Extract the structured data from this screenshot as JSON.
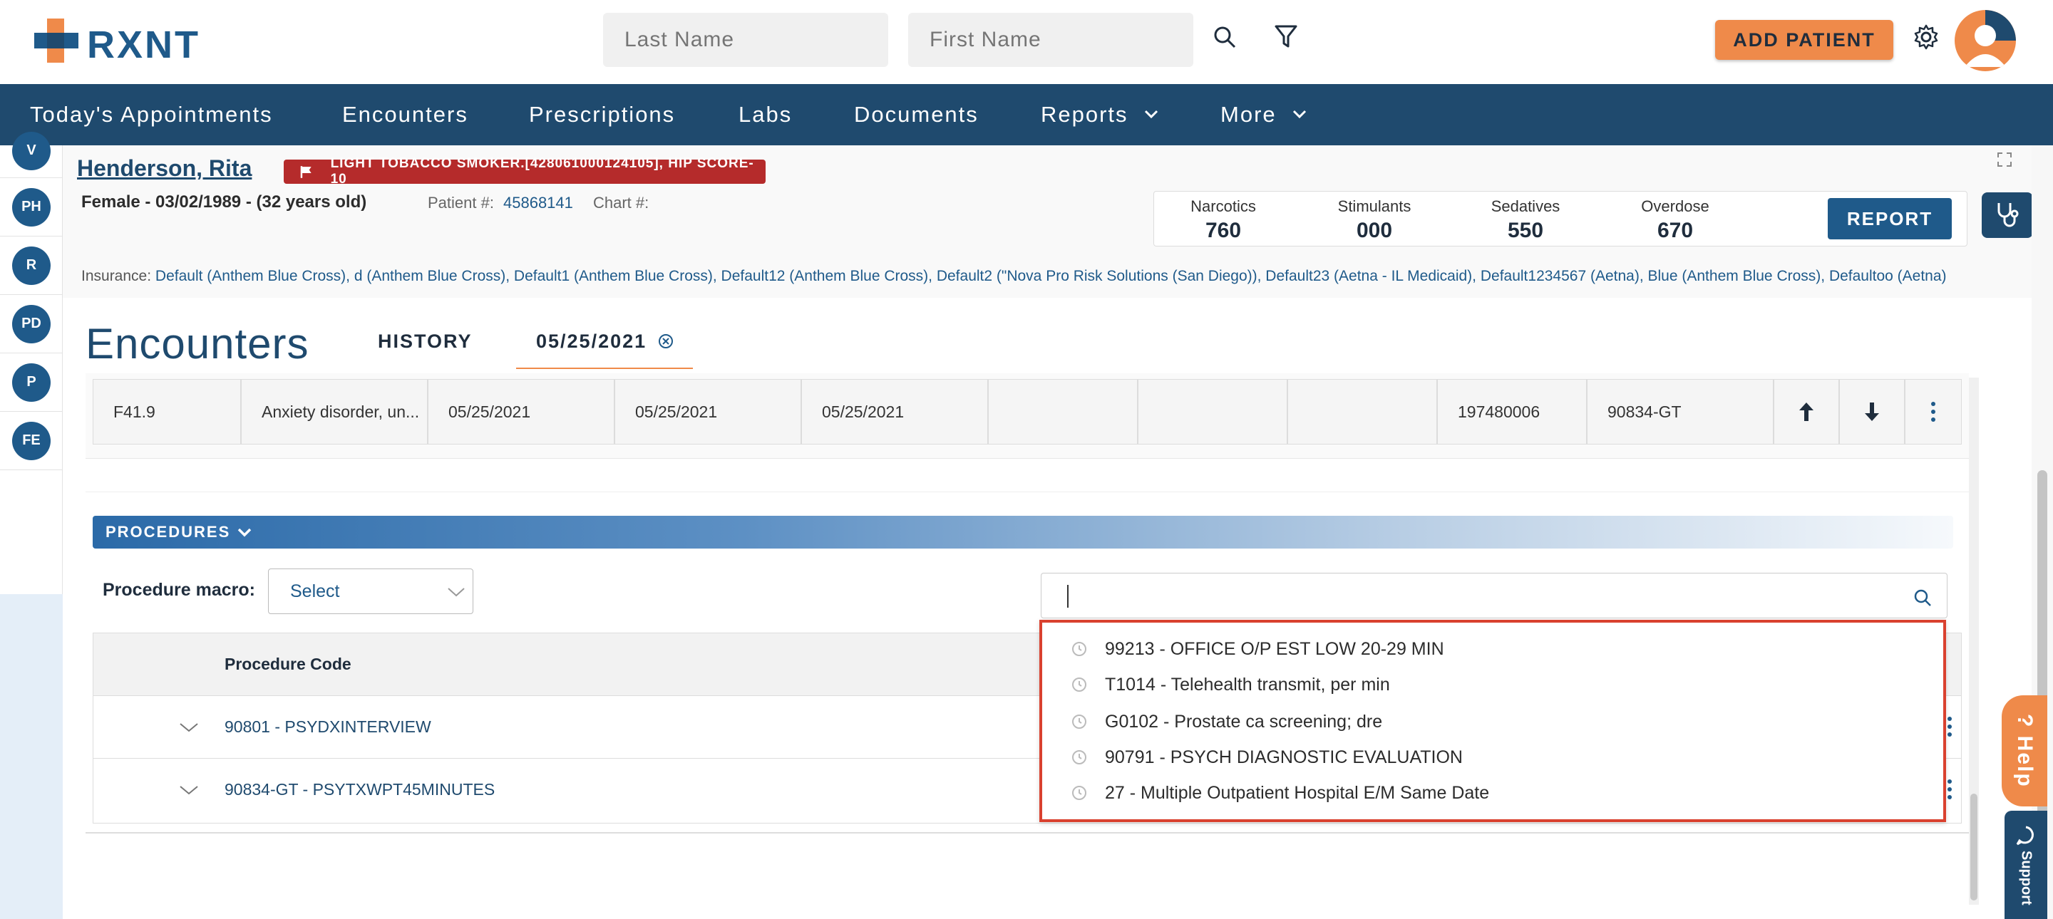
{
  "header": {
    "logo_text": "RXNT",
    "last_name_placeholder": "Last Name",
    "first_name_placeholder": "First Name",
    "add_patient_label": "ADD PATIENT",
    "accent_color": "#ef8a4a",
    "brand_color": "#1f4a6e"
  },
  "nav": {
    "items": [
      "Today's Appointments",
      "Encounters",
      "Prescriptions",
      "Labs",
      "Documents",
      "Reports",
      "More"
    ]
  },
  "sidebar": {
    "items": [
      "V",
      "PH",
      "R",
      "PD",
      "P",
      "FE"
    ]
  },
  "patient": {
    "name": "Henderson, Rita",
    "alert": "LIGHT TOBACCO SMOKER.[428061000124105], HIP SCORE- 10",
    "demographics": "Female - 03/02/1989 - (32 years old)",
    "patient_no_label": "Patient #:",
    "patient_no": "45868141",
    "chart_label": "Chart #:",
    "insurance_label": "Insurance:",
    "insurance": "Default (Anthem Blue Cross), d (Anthem Blue Cross), Default1 (Anthem Blue Cross), Default12 (Anthem Blue Cross), Default2 (\"Nova Pro Risk Solutions (San Diego)), Default23 (Aetna - IL Medicaid), Default1234567 (Aetna), Blue (Anthem Blue Cross), Defaultoo (Aetna)"
  },
  "stats": {
    "narcotics_label": "Narcotics",
    "narcotics": "760",
    "stimulants_label": "Stimulants",
    "stimulants": "000",
    "sedatives_label": "Sedatives",
    "sedatives": "550",
    "overdose_label": "Overdose",
    "overdose": "670",
    "report_label": "REPORT"
  },
  "encounters": {
    "title": "Encounters",
    "tab_history": "HISTORY",
    "tab_date": "05/25/2021"
  },
  "diagnosis_row": {
    "code": "F41.9",
    "description": "Anxiety disorder, un...",
    "date1": "05/25/2021",
    "date2": "05/25/2021",
    "date3": "05/25/2021",
    "snomed": "197480006",
    "cpt": "90834-GT"
  },
  "procedures": {
    "banner": "PROCEDURES",
    "macro_label": "Procedure macro:",
    "macro_value": "Select",
    "search_value": "",
    "column_header": "Procedure Code",
    "rows": [
      "90801 - PSYDXINTERVIEW",
      "90834-GT - PSYTXWPT45MINUTES"
    ],
    "suggestions": [
      "99213 - OFFICE O/P EST LOW 20-29 MIN",
      "T1014 - Telehealth transmit, per min",
      "G0102 - Prostate ca screening; dre",
      "90791 - PSYCH DIAGNOSTIC EVALUATION",
      "27 - Multiple Outpatient Hospital E/M Same Date"
    ]
  },
  "side_tabs": {
    "help": "Help",
    "support": "Support"
  }
}
